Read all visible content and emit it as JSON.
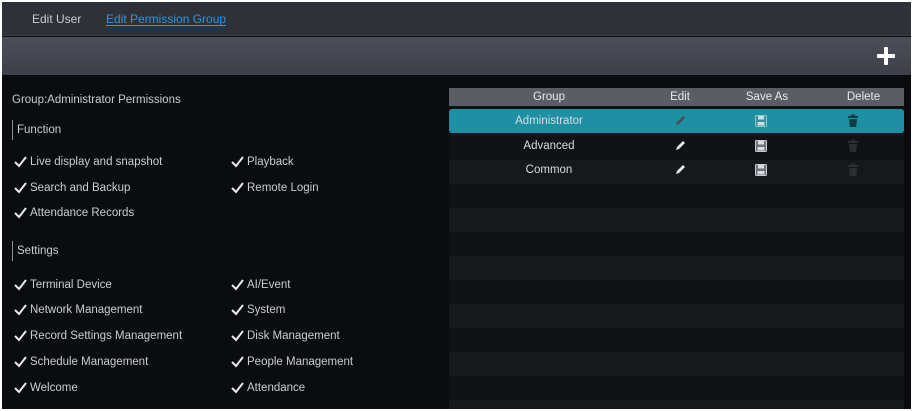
{
  "tabs": [
    {
      "label": "Edit User",
      "active": false
    },
    {
      "label": "Edit Permission Group",
      "active": true
    }
  ],
  "toolbar": {
    "add_icon": "plus-icon"
  },
  "permissions": {
    "group_title": "Group:Administrator Permissions",
    "function": {
      "header": "Function",
      "items": [
        "Live display and snapshot",
        "Playback",
        "Search and Backup",
        "Remote Login",
        "Attendance Records"
      ]
    },
    "settings": {
      "header": "Settings",
      "items": [
        "Terminal Device",
        "AI/Event",
        "Network Management",
        "System",
        "Record Settings Management",
        "Disk Management",
        "Schedule Management",
        "People Management",
        "Welcome",
        "Attendance"
      ]
    }
  },
  "table": {
    "headers": [
      "Group",
      "Edit",
      "Save As",
      "Delete"
    ],
    "rows": [
      {
        "group": "Administrator",
        "selected": true,
        "delete_enabled": true
      },
      {
        "group": "Advanced",
        "selected": false,
        "delete_enabled": false
      },
      {
        "group": "Common",
        "selected": false,
        "delete_enabled": false
      }
    ]
  },
  "colors": {
    "accent_tab": "#2f96e0",
    "selected_row": "#1f8fa3",
    "background": "#0b0c10"
  }
}
